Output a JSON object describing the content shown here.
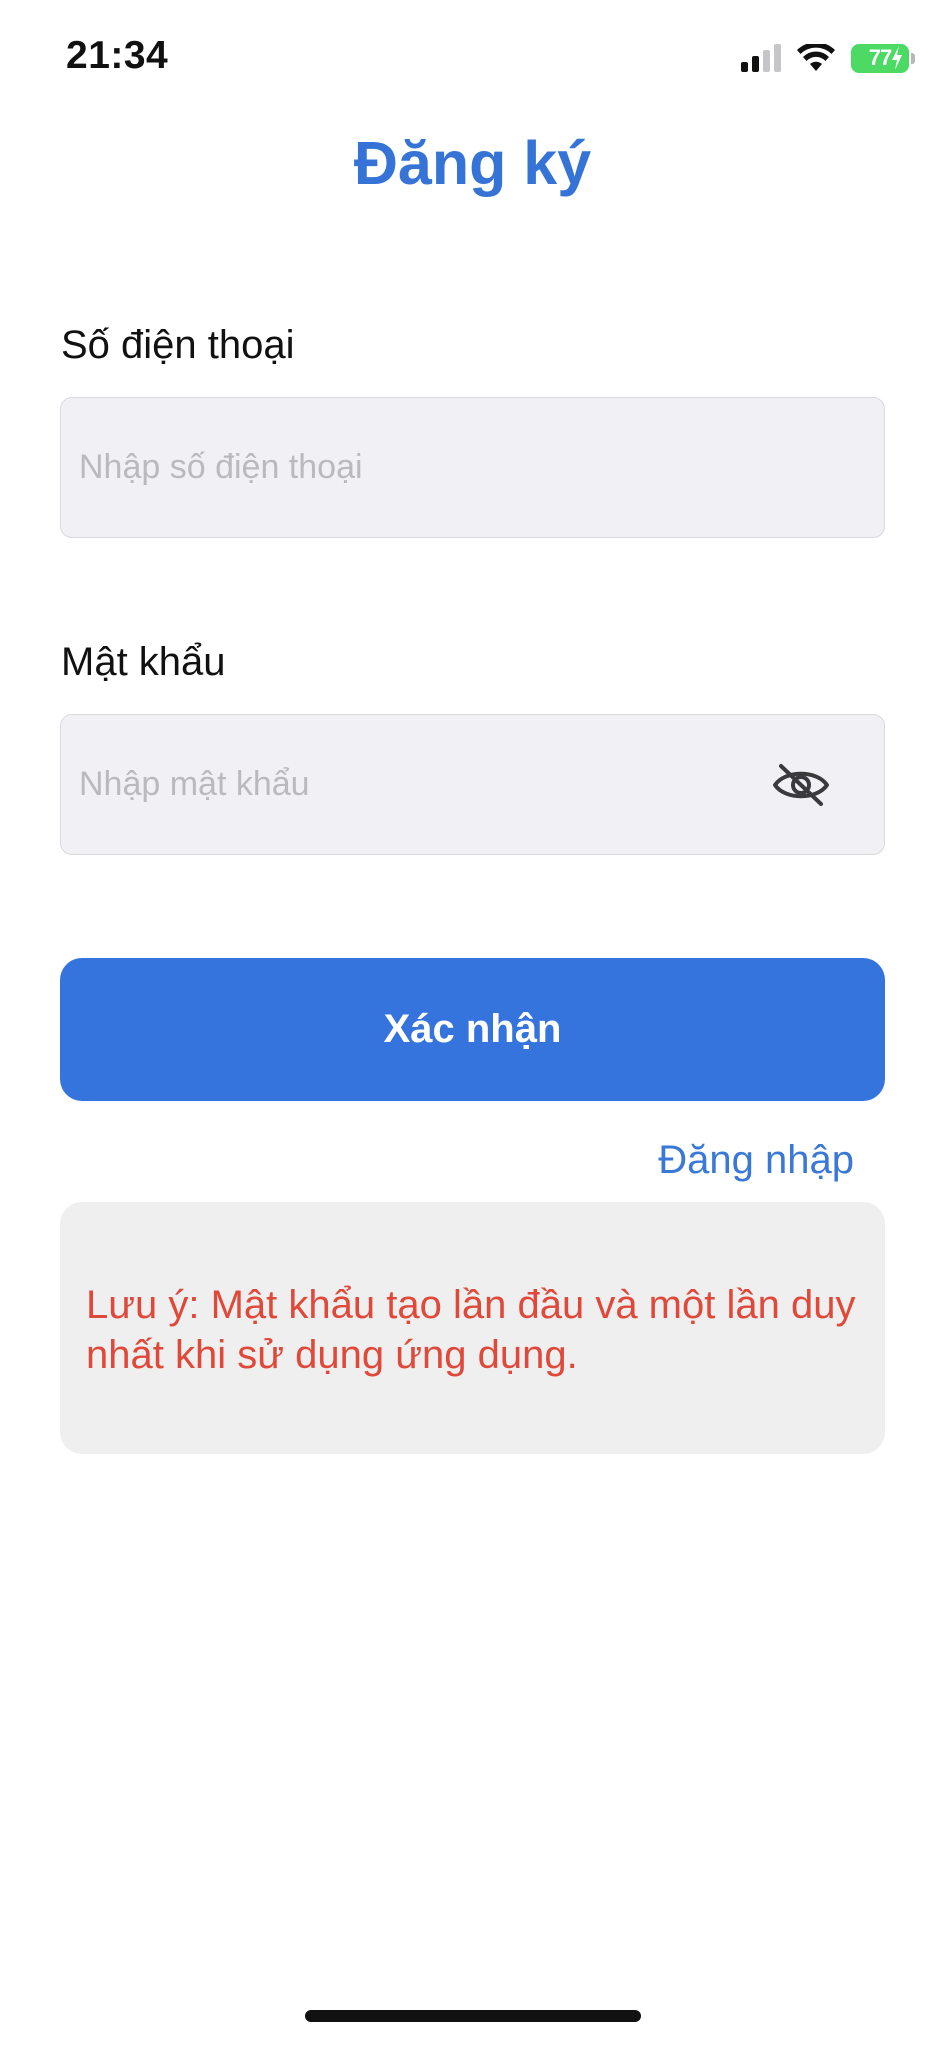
{
  "status_bar": {
    "time": "21:34",
    "battery_level": "77",
    "signal_bars_active": 2,
    "signal_bars_total": 4
  },
  "header": {
    "title": "Đăng ký"
  },
  "form": {
    "phone": {
      "label": "Số điện thoại",
      "placeholder": "Nhập số điện thoại",
      "value": ""
    },
    "password": {
      "label": "Mật khẩu",
      "placeholder": "Nhập mật khẩu",
      "value": "",
      "toggle_icon": "eye-slash-icon"
    }
  },
  "actions": {
    "submit_label": "Xác nhận",
    "login_link_label": "Đăng nhập"
  },
  "note": {
    "text": "Lưu ý: Mật khẩu tạo lần đầu và một lần duy nhất khi sử dụng ứng dụng."
  },
  "colors": {
    "accent": "#3574dc",
    "title": "#3574d6",
    "note_text": "#e0493a",
    "input_bg": "#f1f1f5",
    "battery": "#4cd964"
  }
}
